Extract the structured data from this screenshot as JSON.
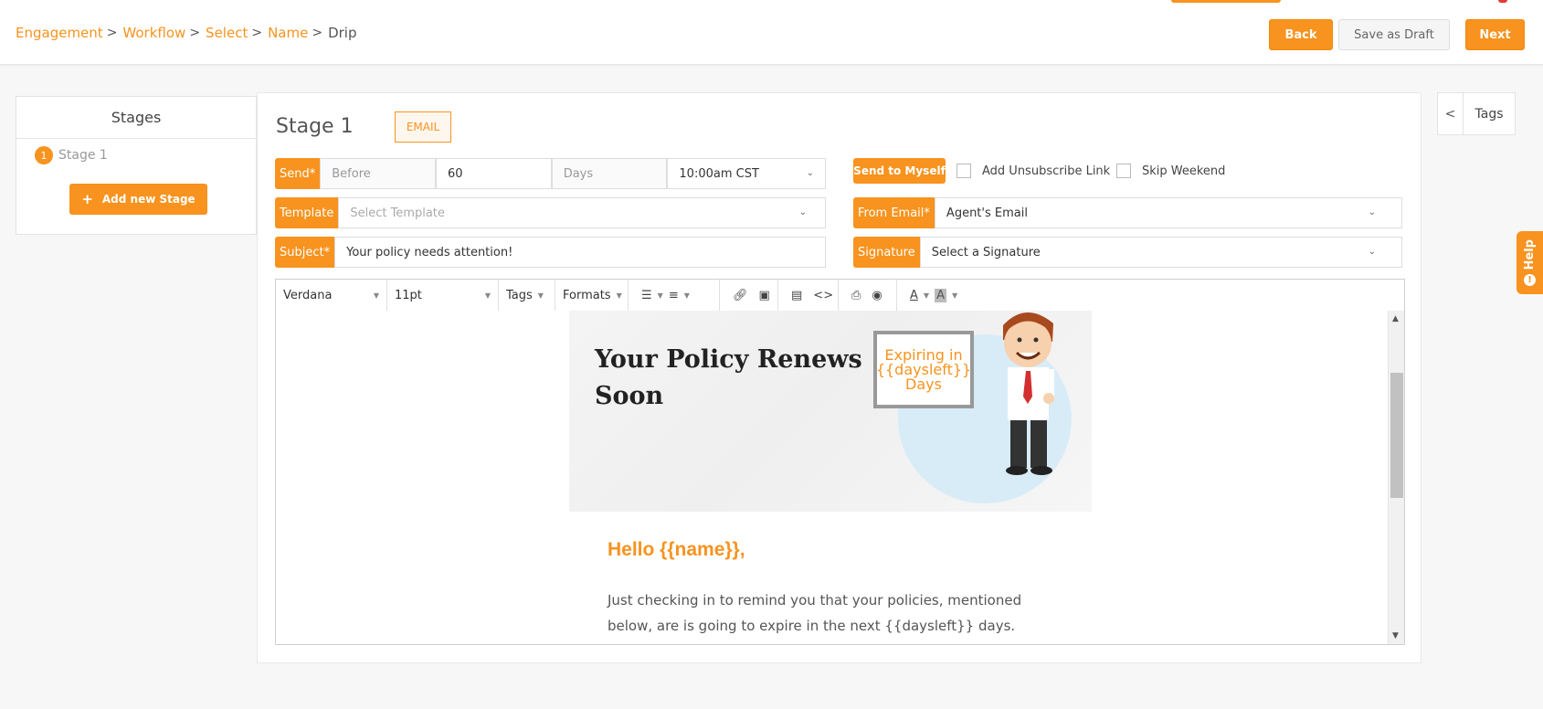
{
  "breadcrumb": {
    "items": [
      "Engagement",
      "Workflow",
      "Select",
      "Name"
    ],
    "current": "Drip"
  },
  "header": {
    "back_label": "Back",
    "draft_label": "Save as Draft",
    "next_label": "Next"
  },
  "stages": {
    "title": "Stages",
    "items": [
      {
        "num": "1",
        "label": "Stage 1"
      }
    ],
    "add_label": "Add new Stage"
  },
  "stage": {
    "heading": "Stage 1",
    "type_badge": "EMAIL"
  },
  "send": {
    "label": "Send*",
    "timing": "Before",
    "amount": "60",
    "unit": "Days",
    "time": "10:00am CST"
  },
  "send_to_myself_label": "Send to Myself",
  "add_unsubscribe_label": "Add Unsubscribe Link",
  "skip_weekend_label": "Skip Weekend",
  "template": {
    "label": "Template",
    "placeholder": "Select Template"
  },
  "from_email": {
    "label": "From Email*",
    "value": "Agent's Email"
  },
  "subject": {
    "label": "Subject*",
    "value": "Your policy needs attention!"
  },
  "signature": {
    "label": "Signature",
    "value": "Select a Signature"
  },
  "toolbar": {
    "font": "Verdana",
    "size": "11pt",
    "tags": "Tags",
    "formats": "Formats"
  },
  "email_body": {
    "hero_title": "Your Policy Renews Soon",
    "sign_text": "Expiring in {{daysleft}} Days",
    "greeting": "Hello {{name}},",
    "paragraph": "Just checking in to remind you that your policies, mentioned below, are is going to expire in the next {{daysleft}} days."
  },
  "tags_panel": {
    "label": "Tags"
  },
  "help_label": "Help",
  "colors": {
    "accent": "#f7931e",
    "text": "#333333"
  }
}
